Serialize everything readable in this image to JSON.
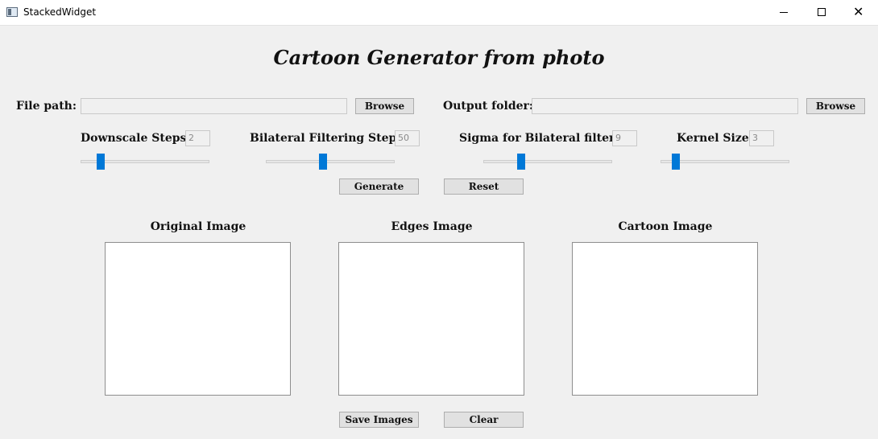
{
  "window": {
    "title": "StackedWidget",
    "icon": "app-window-icon",
    "controls": {
      "minimize_icon": "minimize-icon",
      "maximize_icon": "maximize-icon",
      "close_glyph": "✕"
    }
  },
  "header": {
    "title": "Cartoon Generator from photo"
  },
  "file_path": {
    "label": "File path:",
    "value": "",
    "browse_label": "Browse"
  },
  "output_folder": {
    "label": "Output folder:",
    "value": "",
    "browse_label": "Browse"
  },
  "parameters": [
    {
      "label": "Downscale Steps:",
      "value": "2",
      "slider_level_pct": 13
    },
    {
      "label": "Bilateral Filtering Steps:",
      "value": "50",
      "slider_level_pct": 44
    },
    {
      "label": "Sigma for Bilateral filter:",
      "value": "9",
      "slider_level_pct": 28
    },
    {
      "label": "Kernel Size:",
      "value": "3",
      "slider_level_pct": 9
    }
  ],
  "actions": {
    "generate_label": "Generate",
    "reset_label": "Reset",
    "save_label": "Save Images",
    "clear_label": "Clear"
  },
  "images": {
    "original_title": "Original Image",
    "edges_title": "Edges Image",
    "cartoon_title": "Cartoon Image"
  },
  "colors": {
    "accent": "#0078d7",
    "background": "#f0f0f0",
    "panel": "#ffffff"
  }
}
